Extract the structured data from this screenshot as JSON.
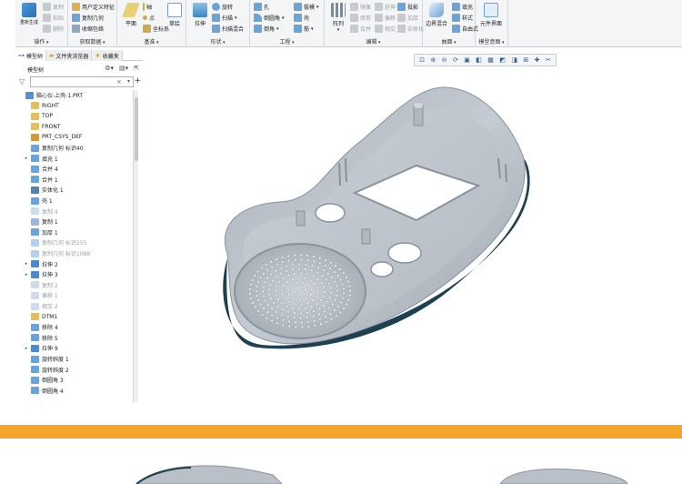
{
  "ribbon": {
    "groups": [
      {
        "label": "操作",
        "buttons": [
          {
            "id": "regen",
            "label": "重新生成",
            "big": true
          },
          {
            "id": "copy",
            "label": "复制"
          },
          {
            "id": "paste",
            "label": "粘贴"
          },
          {
            "id": "delete",
            "label": "删除"
          }
        ]
      },
      {
        "label": "获取数据",
        "buttons": [
          {
            "id": "udf",
            "label": "用户定义特征"
          },
          {
            "id": "copy-geom",
            "label": "复制几何"
          },
          {
            "id": "shrinkwrap",
            "label": "收缩包络"
          }
        ]
      },
      {
        "label": "基准",
        "buttons": [
          {
            "id": "plane",
            "label": "平面",
            "big": true
          },
          {
            "id": "axis",
            "label": "轴"
          },
          {
            "id": "point",
            "label": "点"
          },
          {
            "id": "csys",
            "label": "坐标系"
          },
          {
            "id": "sketch",
            "label": "草绘",
            "big": true
          }
        ]
      },
      {
        "label": "形状",
        "buttons": [
          {
            "id": "extrude",
            "label": "拉伸",
            "big": true
          },
          {
            "id": "revolve",
            "label": "旋转"
          },
          {
            "id": "sweep",
            "label": "扫描"
          },
          {
            "id": "swept-blend",
            "label": "扫描混合"
          }
        ]
      },
      {
        "label": "工程",
        "buttons": [
          {
            "id": "hole",
            "label": "孔"
          },
          {
            "id": "round",
            "label": "倒圆角"
          },
          {
            "id": "chamfer",
            "label": "倒角"
          },
          {
            "id": "draft",
            "label": "拔模"
          },
          {
            "id": "shell",
            "label": "壳"
          },
          {
            "id": "rib",
            "label": "筋"
          }
        ]
      },
      {
        "label": "编辑",
        "buttons": [
          {
            "id": "pattern",
            "label": "阵列",
            "big": true
          },
          {
            "id": "mirror",
            "label": "镜像"
          },
          {
            "id": "trim",
            "label": "修剪"
          },
          {
            "id": "merge",
            "label": "合并"
          },
          {
            "id": "extend",
            "label": "延伸"
          },
          {
            "id": "offset",
            "label": "偏移"
          },
          {
            "id": "intersect",
            "label": "相交"
          },
          {
            "id": "project",
            "label": "投影"
          },
          {
            "id": "thicken",
            "label": "加厚"
          },
          {
            "id": "solidify",
            "label": "实体化"
          }
        ]
      },
      {
        "label": "曲面",
        "buttons": [
          {
            "id": "boundary-blend",
            "label": "边界混合",
            "big": true
          },
          {
            "id": "fill",
            "label": "填充"
          },
          {
            "id": "style",
            "label": "样式"
          },
          {
            "id": "freeform",
            "label": "自由式"
          }
        ]
      },
      {
        "label": "模型意图",
        "buttons": [
          {
            "id": "component-interface",
            "label": "元件界面",
            "big": true
          }
        ]
      }
    ]
  },
  "panel": {
    "tabs": [
      "模型树",
      "文件夹浏览器",
      "收藏夹"
    ],
    "tree_label": "模型树",
    "search_placeholder": ""
  },
  "tree": {
    "items": [
      {
        "label": "脑心仪-上壳-1.PRT",
        "icon": "part-icon",
        "level": 0,
        "expand": false,
        "dim": false
      },
      {
        "label": "RIGHT",
        "icon": "datum-plane-icon",
        "level": 1,
        "expand": false,
        "dim": false
      },
      {
        "label": "TOP",
        "icon": "datum-plane-icon",
        "level": 1,
        "expand": false,
        "dim": false
      },
      {
        "label": "FRONT",
        "icon": "datum-plane-icon",
        "level": 1,
        "expand": false,
        "dim": false
      },
      {
        "label": "PRT_CSYS_DEF",
        "icon": "csys-icon",
        "level": 1,
        "expand": false,
        "dim": false
      },
      {
        "label": "复制几何 标识40",
        "icon": "copy-geom-icon",
        "level": 1,
        "expand": false,
        "dim": false
      },
      {
        "label": "填充 1",
        "icon": "fill-icon",
        "level": 1,
        "expand": true,
        "dim": false
      },
      {
        "label": "合并 4",
        "icon": "merge-icon",
        "level": 1,
        "expand": false,
        "dim": false
      },
      {
        "label": "合并 1",
        "icon": "merge-icon",
        "level": 1,
        "expand": false,
        "dim": false
      },
      {
        "label": "实体化 1",
        "icon": "solidify-icon",
        "level": 1,
        "expand": false,
        "dim": false
      },
      {
        "label": "壳 1",
        "icon": "shell-icon",
        "level": 1,
        "expand": false,
        "dim": false
      },
      {
        "label": "复制 4",
        "icon": "copy-icon",
        "level": 1,
        "expand": false,
        "dim": true
      },
      {
        "label": "复制 1",
        "icon": "copy-icon",
        "level": 1,
        "expand": false,
        "dim": false
      },
      {
        "label": "加厚 1",
        "icon": "thicken-icon",
        "level": 1,
        "expand": false,
        "dim": false
      },
      {
        "label": "复制几何 标识255",
        "icon": "copy-geom-icon",
        "level": 1,
        "expand": false,
        "dim": true
      },
      {
        "label": "复制几何 标识1088",
        "icon": "copy-geom-icon",
        "level": 1,
        "expand": false,
        "dim": true
      },
      {
        "label": "拉伸 2",
        "icon": "extrude-icon",
        "level": 1,
        "expand": true,
        "dim": false
      },
      {
        "label": "拉伸 3",
        "icon": "extrude-icon",
        "level": 1,
        "expand": true,
        "dim": false
      },
      {
        "label": "复制 2",
        "icon": "copy-icon",
        "level": 1,
        "expand": false,
        "dim": true
      },
      {
        "label": "偏移 1",
        "icon": "offset-icon",
        "level": 1,
        "expand": false,
        "dim": true
      },
      {
        "label": "相交 2",
        "icon": "intersect-icon",
        "level": 1,
        "expand": false,
        "dim": true
      },
      {
        "label": "DTM1",
        "icon": "datum-plane-icon",
        "level": 1,
        "expand": false,
        "dim": false
      },
      {
        "label": "移除 4",
        "icon": "remove-icon",
        "level": 1,
        "expand": false,
        "dim": false
      },
      {
        "label": "移除 5",
        "icon": "remove-icon",
        "level": 1,
        "expand": false,
        "dim": false
      },
      {
        "label": "拉伸 9",
        "icon": "extrude-icon",
        "level": 1,
        "expand": true,
        "dim": false
      },
      {
        "label": "旋转斜度 1",
        "icon": "draft-icon",
        "level": 1,
        "expand": false,
        "dim": false
      },
      {
        "label": "旋转斜度 2",
        "icon": "draft-icon",
        "level": 1,
        "expand": false,
        "dim": false
      },
      {
        "label": "倒圆角 3",
        "icon": "round-icon",
        "level": 1,
        "expand": false,
        "dim": false
      },
      {
        "label": "倒圆角 4",
        "icon": "round-icon",
        "level": 1,
        "expand": false,
        "dim": false
      }
    ]
  },
  "gfx_toolbar": {
    "icons": [
      "refit-icon",
      "zoom-in-icon",
      "zoom-out-icon",
      "repaint-icon",
      "view-manager-icon",
      "display-style-icon",
      "saved-views-icon",
      "perspective-icon",
      "datum-display-icon",
      "annotation-icon",
      "spin-center-icon",
      "section-icon"
    ]
  },
  "colors": {
    "accent": "#356fae",
    "part_gray": "#b9c0c8",
    "part_dark": "#1e4152",
    "orange": "#f5a52a"
  }
}
